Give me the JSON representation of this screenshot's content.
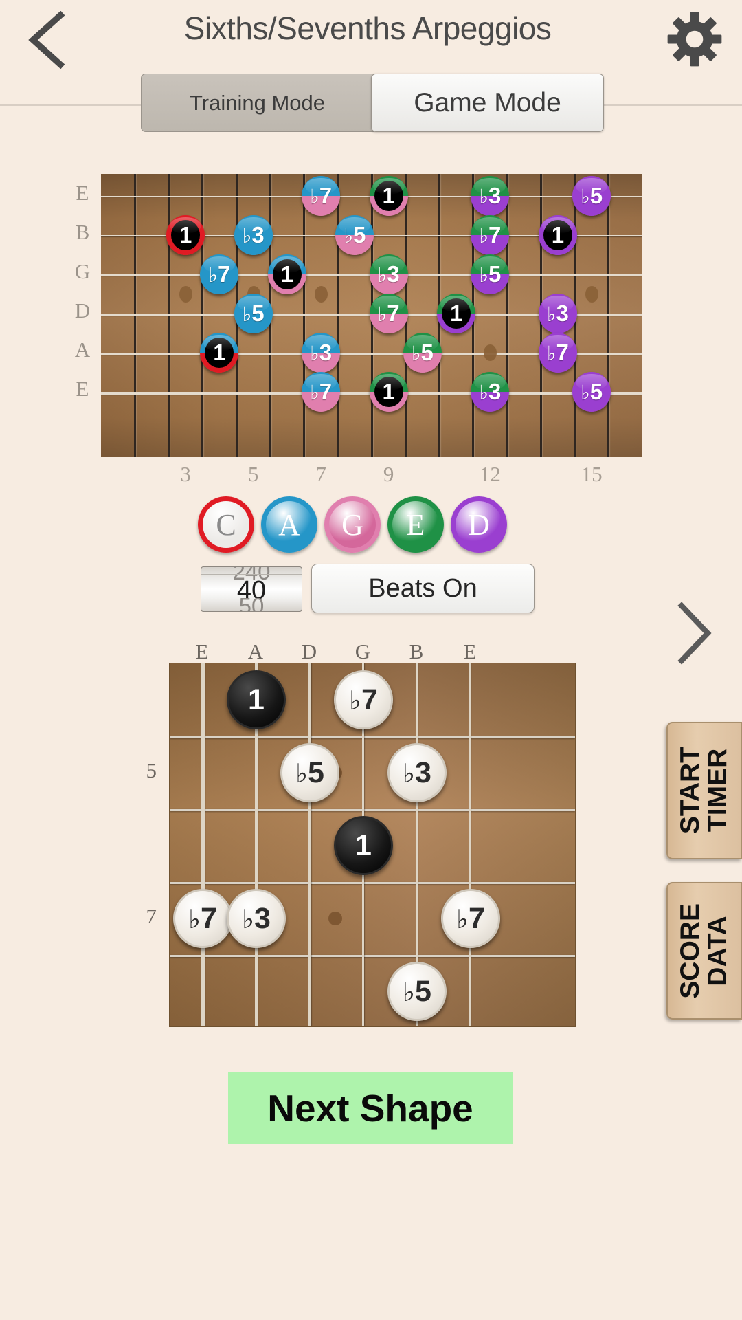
{
  "header": {
    "title": "Sixths/Sevenths Arpeggios",
    "back_icon": "chevron-left-icon",
    "settings_icon": "gear-icon"
  },
  "mode_switch": {
    "tabs": [
      {
        "label": "Training Mode",
        "selected": false
      },
      {
        "label": "Game Mode",
        "selected": true
      }
    ]
  },
  "fretboard": {
    "string_labels": [
      "E",
      "B",
      "G",
      "D",
      "A",
      "E"
    ],
    "fret_numbers": [
      "3",
      "5",
      "7",
      "9",
      "12",
      "15"
    ],
    "fret_number_positions": [
      3,
      5,
      7,
      9,
      12,
      15
    ],
    "colors": {
      "C": "#e01b24",
      "A": "#2596c8",
      "G": "#e07fae",
      "E": "#1f9146",
      "D": "#9a3fd0"
    },
    "notes": [
      {
        "string": 0,
        "fret": 7,
        "label": "♭7",
        "top": "#2596c8",
        "bottom": "#e07fae",
        "root": false
      },
      {
        "string": 0,
        "fret": 9,
        "label": "1",
        "top": "#1f9146",
        "bottom": "#e07fae",
        "root": true
      },
      {
        "string": 0,
        "fret": 12,
        "label": "♭3",
        "top": "#1f9146",
        "bottom": "#9a3fd0",
        "root": false
      },
      {
        "string": 0,
        "fret": 15,
        "label": "♭5",
        "top": "#9a3fd0",
        "bottom": "#9a3fd0",
        "root": false
      },
      {
        "string": 1,
        "fret": 3,
        "label": "1",
        "top": "#e01b24",
        "bottom": "#e01b24",
        "root": true
      },
      {
        "string": 1,
        "fret": 5,
        "label": "♭3",
        "top": "#2596c8",
        "bottom": "#2596c8",
        "root": false
      },
      {
        "string": 1,
        "fret": 8,
        "label": "♭5",
        "top": "#2596c8",
        "bottom": "#e07fae",
        "root": false
      },
      {
        "string": 1,
        "fret": 12,
        "label": "♭7",
        "top": "#1f9146",
        "bottom": "#9a3fd0",
        "root": false
      },
      {
        "string": 1,
        "fret": 14,
        "label": "1",
        "top": "#9a3fd0",
        "bottom": "#9a3fd0",
        "root": true
      },
      {
        "string": 2,
        "fret": 4,
        "label": "♭7",
        "top": "#2596c8",
        "bottom": "#2596c8",
        "root": false
      },
      {
        "string": 2,
        "fret": 6,
        "label": "1",
        "top": "#2596c8",
        "bottom": "#e07fae",
        "root": true
      },
      {
        "string": 2,
        "fret": 9,
        "label": "♭3",
        "top": "#1f9146",
        "bottom": "#e07fae",
        "root": false
      },
      {
        "string": 2,
        "fret": 12,
        "label": "♭5",
        "top": "#1f9146",
        "bottom": "#9a3fd0",
        "root": false
      },
      {
        "string": 3,
        "fret": 5,
        "label": "♭5",
        "top": "#2596c8",
        "bottom": "#2596c8",
        "root": false
      },
      {
        "string": 3,
        "fret": 9,
        "label": "♭7",
        "top": "#1f9146",
        "bottom": "#e07fae",
        "root": false
      },
      {
        "string": 3,
        "fret": 11,
        "label": "1",
        "top": "#1f9146",
        "bottom": "#9a3fd0",
        "root": true
      },
      {
        "string": 3,
        "fret": 14,
        "label": "♭3",
        "top": "#9a3fd0",
        "bottom": "#9a3fd0",
        "root": false
      },
      {
        "string": 4,
        "fret": 4,
        "label": "1",
        "top": "#2596c8",
        "bottom": "#e01b24",
        "root": true
      },
      {
        "string": 4,
        "fret": 7,
        "label": "♭3",
        "top": "#2596c8",
        "bottom": "#e07fae",
        "root": false
      },
      {
        "string": 4,
        "fret": 10,
        "label": "♭5",
        "top": "#1f9146",
        "bottom": "#e07fae",
        "root": false
      },
      {
        "string": 4,
        "fret": 14,
        "label": "♭7",
        "top": "#9a3fd0",
        "bottom": "#9a3fd0",
        "root": false
      },
      {
        "string": 5,
        "fret": 7,
        "label": "♭7",
        "top": "#2596c8",
        "bottom": "#e07fae",
        "root": false
      },
      {
        "string": 5,
        "fret": 9,
        "label": "1",
        "top": "#1f9146",
        "bottom": "#e07fae",
        "root": true
      },
      {
        "string": 5,
        "fret": 12,
        "label": "♭3",
        "top": "#1f9146",
        "bottom": "#9a3fd0",
        "root": false
      },
      {
        "string": 5,
        "fret": 15,
        "label": "♭5",
        "top": "#9a3fd0",
        "bottom": "#9a3fd0",
        "root": false
      }
    ]
  },
  "caged_buttons": [
    {
      "letter": "C",
      "ring": "#e01b24",
      "core": "#eceae7",
      "text": "#8a8a8a",
      "selected": false
    },
    {
      "letter": "A",
      "ring": "#2596c8",
      "core": "#2596c8",
      "text": "#ffffff",
      "selected": true
    },
    {
      "letter": "G",
      "ring": "#e07fae",
      "core": "#d4679b",
      "text": "#ffffff",
      "selected": true
    },
    {
      "letter": "E",
      "ring": "#1f9146",
      "core": "#1f9146",
      "text": "#ffffff",
      "selected": true
    },
    {
      "letter": "D",
      "ring": "#9a3fd0",
      "core": "#9a3fd0",
      "text": "#ffffff",
      "selected": true
    }
  ],
  "tempo": {
    "previous": "240",
    "value": "40",
    "next": "50"
  },
  "beats_button": {
    "label": "Beats On"
  },
  "next_arrow": {
    "icon": "chevron-right-icon"
  },
  "side_buttons": [
    {
      "line1": "START",
      "line2": "TIMER"
    },
    {
      "line1": "SCORE",
      "line2": "DATA"
    }
  ],
  "shape_diagram": {
    "string_labels": [
      "E",
      "A",
      "D",
      "G",
      "B",
      "E"
    ],
    "fret_numbers": [
      {
        "label": "5",
        "row": 1
      },
      {
        "label": "7",
        "row": 3
      }
    ],
    "notes": [
      {
        "string": 1,
        "row": 0,
        "label": "1",
        "style": "black"
      },
      {
        "string": 3,
        "row": 0,
        "label": "♭7",
        "style": "white"
      },
      {
        "string": 2,
        "row": 1,
        "label": "♭5",
        "style": "white"
      },
      {
        "string": 4,
        "row": 1,
        "label": "♭3",
        "style": "white"
      },
      {
        "string": 3,
        "row": 2,
        "label": "1",
        "style": "black"
      },
      {
        "string": 0,
        "row": 3,
        "label": "♭7",
        "style": "white"
      },
      {
        "string": 1,
        "row": 3,
        "label": "♭3",
        "style": "white"
      },
      {
        "string": 5,
        "row": 3,
        "label": "♭7",
        "style": "white"
      },
      {
        "string": 4,
        "row": 4,
        "label": "♭5",
        "style": "white"
      }
    ]
  },
  "next_shape_button": {
    "label": "Next Shape"
  }
}
